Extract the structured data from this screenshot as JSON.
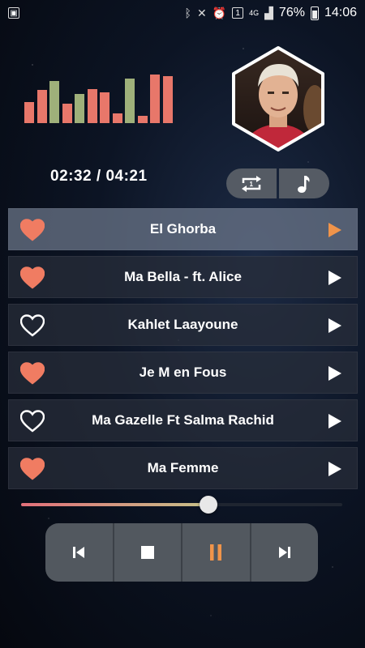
{
  "status_bar": {
    "time": "14:06",
    "battery": "76%",
    "network": "4G",
    "notification_badge": "1",
    "icons": [
      "gallery-icon",
      "bluetooth-icon",
      "mute-icon",
      "alarm-icon",
      "notification-badge",
      "signal-icon",
      "battery-icon"
    ]
  },
  "player": {
    "current_time": "02:32",
    "separator": " / ",
    "total_time": "04:21",
    "progress": 0.58,
    "artist_photo": "artist-portrait"
  },
  "equalizer": {
    "levels": [
      0.42,
      0.66,
      0.84,
      0.38,
      0.58,
      0.68,
      0.62,
      0.2,
      0.88,
      0.14,
      0.96,
      0.94
    ],
    "colors": [
      "#e8776a",
      "#e8776a",
      "#9fb07a",
      "#e8776a",
      "#9fb07a",
      "#e8776a",
      "#e8776a",
      "#e8776a",
      "#9fb07a",
      "#e8776a",
      "#e8776a",
      "#e8776a"
    ]
  },
  "toggles": [
    {
      "name": "repeat-icon"
    },
    {
      "name": "music-note-icon"
    }
  ],
  "playlist": [
    {
      "title": "El Ghorba",
      "favorite": true,
      "active": true
    },
    {
      "title": "Ma Bella - ft. Alice",
      "favorite": true,
      "active": false
    },
    {
      "title": "Kahlet Laayoune",
      "favorite": false,
      "active": false
    },
    {
      "title": "Je M en Fous",
      "favorite": true,
      "active": false
    },
    {
      "title": "Ma Gazelle Ft Salma Rachid",
      "favorite": false,
      "active": false
    },
    {
      "title": "Ma Femme",
      "favorite": true,
      "active": false
    }
  ],
  "controls": [
    "previous-icon",
    "stop-icon",
    "pause-icon",
    "next-icon"
  ],
  "colors": {
    "accent": "#f0944a",
    "heart": "#f07c62",
    "button_bg": "#52585f"
  }
}
